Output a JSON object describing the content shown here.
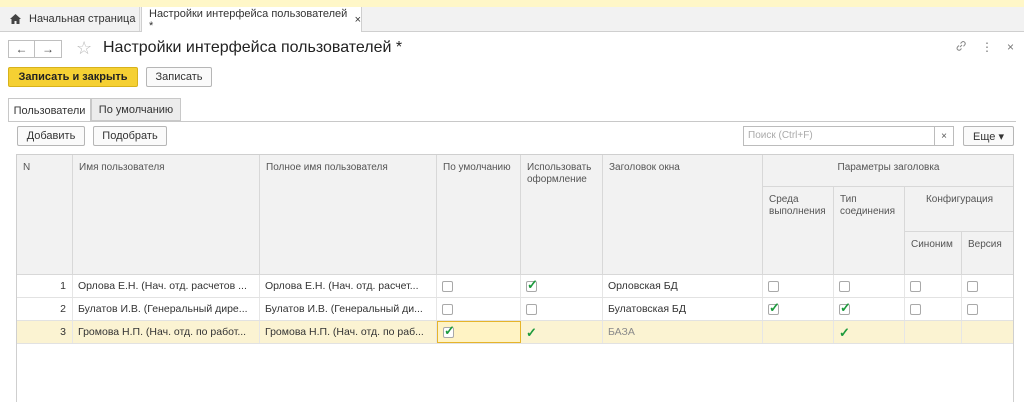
{
  "tabs": {
    "home_label": "Начальная страница",
    "doc_label": "Настройки интерфейса пользователей *",
    "close": "×"
  },
  "header": {
    "back": "←",
    "forward": "→",
    "star": "☆",
    "title": "Настройки интерфейса пользователей *",
    "link_icon": "🔗",
    "more_icon": "⋮",
    "close_icon": "×"
  },
  "toolbar": {
    "save_close": "Записать и закрыть",
    "save": "Записать"
  },
  "form_tabs": [
    "Пользователи",
    "По умолчанию"
  ],
  "list_toolbar": {
    "add": "Добавить",
    "select": "Подобрать",
    "search_placeholder": "Поиск (Ctrl+F)",
    "clear": "×",
    "more": "Еще ▾"
  },
  "table": {
    "headers": {
      "n": "N",
      "user": "Имя пользователя",
      "full": "Полное имя пользователя",
      "default": "По умолчанию",
      "design": "Использовать оформление",
      "window_title": "Заголовок окна",
      "title_params": "Параметры заголовка",
      "env": "Среда выполнения",
      "conn_type": "Тип соединения",
      "config": "Конфигурация",
      "synonym": "Синоним",
      "version": "Версия"
    },
    "rows": [
      {
        "n": "1",
        "user": "Орлова Е.Н. (Нач. отд. расчетов ...",
        "full": "Орлова Е.Н. (Нач. отд. расчет...",
        "title": "Орловская БД",
        "default": false,
        "design": true,
        "env": false,
        "conn": false,
        "syn": false,
        "ver": false
      },
      {
        "n": "2",
        "user": "Булатов И.В. (Генеральный дире...",
        "full": "Булатов И.В. (Генеральный ди...",
        "title": "Булатовская БД",
        "default": false,
        "design": false,
        "env": true,
        "conn": true,
        "syn": false,
        "ver": false
      },
      {
        "n": "3",
        "user": "Громова Н.П. (Нач. отд. по работ...",
        "full": "Громова Н.П. (Нач. отд. по раб...",
        "title": "БАЗА",
        "default": true,
        "design": true,
        "env": false,
        "conn": true,
        "syn": false,
        "ver": false
      }
    ]
  }
}
